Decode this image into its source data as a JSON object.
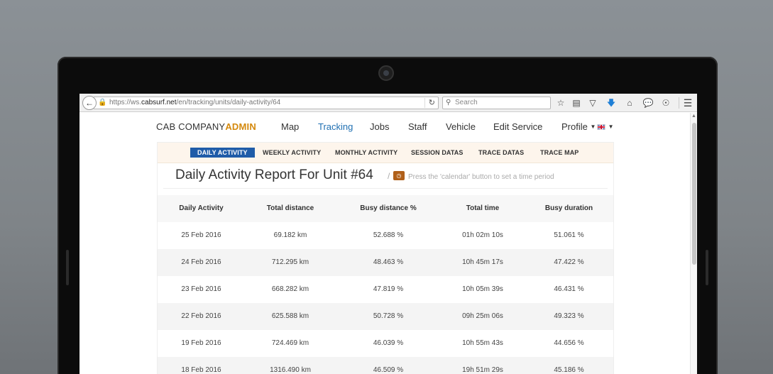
{
  "browser": {
    "url_prefix": "https://ws.",
    "url_domain": "cabsurf.net",
    "url_path": "/en/tracking/units/daily-activity/64",
    "search_placeholder": "Search"
  },
  "site": {
    "brand_main": "CAB COMPANY",
    "brand_accent": "ADMIN",
    "nav": [
      {
        "label": "Map"
      },
      {
        "label": "Tracking"
      },
      {
        "label": "Jobs"
      },
      {
        "label": "Staff"
      },
      {
        "label": "Vehicle"
      },
      {
        "label": "Edit Service"
      },
      {
        "label": "Profile"
      }
    ],
    "accent_color": "#d4890d",
    "active_color": "#1f6fb2"
  },
  "subtabs": [
    {
      "label": "DAILY ACTIVITY"
    },
    {
      "label": "WEEKLY ACTIVITY"
    },
    {
      "label": "MONTHLY ACTIVITY"
    },
    {
      "label": "SESSION DATAS"
    },
    {
      "label": "TRACE DATAS"
    },
    {
      "label": "TRACE MAP"
    }
  ],
  "report": {
    "title": "Daily Activity Report For Unit #64",
    "separator": "/",
    "hint": "Press the 'calendar' button to set a time period"
  },
  "table": {
    "headers": [
      "Daily Activity",
      "Total distance",
      "Busy distance %",
      "Total time",
      "Busy duration"
    ],
    "rows": [
      [
        "25 Feb 2016",
        "69.182 km",
        "52.688 %",
        "01h 02m 10s",
        "51.061 %"
      ],
      [
        "24 Feb 2016",
        "712.295 km",
        "48.463 %",
        "10h 45m 17s",
        "47.422 %"
      ],
      [
        "23 Feb 2016",
        "668.282 km",
        "47.819 %",
        "10h 05m 39s",
        "46.431 %"
      ],
      [
        "22 Feb 2016",
        "625.588 km",
        "50.728 %",
        "09h 25m 06s",
        "49.323 %"
      ],
      [
        "19 Feb 2016",
        "724.469 km",
        "46.039 %",
        "10h 55m 43s",
        "44.656 %"
      ],
      [
        "18 Feb 2016",
        "1316.490 km",
        "46.509 %",
        "19h 51m 29s",
        "45.186 %"
      ]
    ]
  },
  "icons": [
    "back-arrow-icon",
    "lock-icon",
    "reload-icon",
    "search-icon",
    "star-icon",
    "clipboard-icon",
    "pocket-icon",
    "download-icon",
    "home-icon",
    "chat-icon",
    "extension-icon",
    "menu-icon",
    "calendar-icon",
    "uk-flag-icon"
  ]
}
